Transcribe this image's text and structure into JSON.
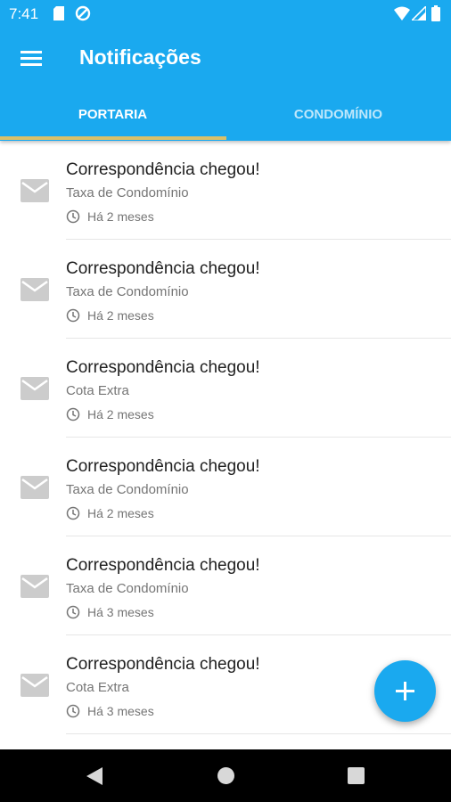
{
  "status_bar": {
    "time": "7:41",
    "icons": [
      "sd-card-icon",
      "sync-icon",
      "wifi-icon",
      "signal-icon",
      "battery-icon"
    ]
  },
  "app_bar": {
    "title": "Notificações",
    "menu_icon": "menu-icon",
    "color": "#1aa9ef"
  },
  "tabs": [
    {
      "label": "PORTARIA",
      "active": true
    },
    {
      "label": "CONDOMÍNIO",
      "active": false
    }
  ],
  "accent_indicator_color": "#d9c06a",
  "notifications": [
    {
      "icon": "mail-icon",
      "title": "Correspondência chegou!",
      "subtitle": "Taxa de Condomínio",
      "time": "Há 2 meses"
    },
    {
      "icon": "mail-icon",
      "title": "Correspondência chegou!",
      "subtitle": "Taxa de Condomínio",
      "time": "Há 2 meses"
    },
    {
      "icon": "mail-icon",
      "title": "Correspondência chegou!",
      "subtitle": "Cota Extra",
      "time": "Há 2 meses"
    },
    {
      "icon": "mail-icon",
      "title": "Correspondência chegou!",
      "subtitle": "Taxa de Condomínio",
      "time": "Há 2 meses"
    },
    {
      "icon": "mail-icon",
      "title": "Correspondência chegou!",
      "subtitle": "Taxa de Condomínio",
      "time": "Há 3 meses"
    },
    {
      "icon": "mail-icon",
      "title": "Correspondência chegou!",
      "subtitle": "Cota Extra",
      "time": "Há 3 meses"
    }
  ],
  "fab": {
    "icon": "plus-icon"
  },
  "nav_bar": {
    "icons": [
      "back-icon",
      "home-icon",
      "recents-icon"
    ]
  }
}
